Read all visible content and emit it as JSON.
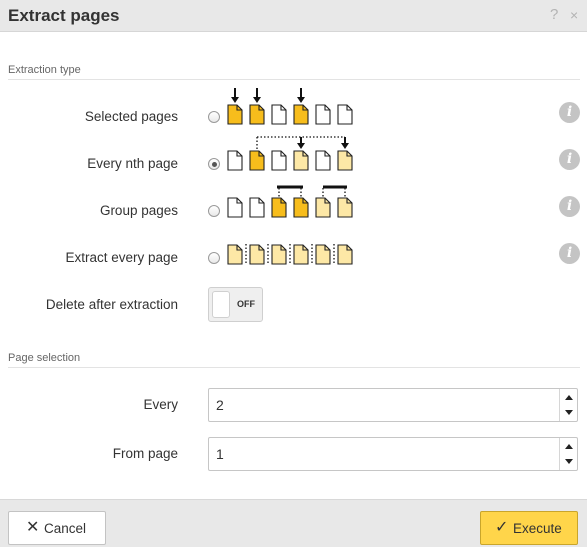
{
  "dialog": {
    "title": "Extract pages",
    "help_icon": "?",
    "close_icon": "×"
  },
  "extraction_type": {
    "section_title": "Extraction type",
    "options": [
      {
        "label": "Selected pages",
        "checked": false,
        "icon": "selected-pages-diagram"
      },
      {
        "label": "Every nth page",
        "checked": true,
        "icon": "every-nth-page-diagram"
      },
      {
        "label": "Group pages",
        "checked": false,
        "icon": "group-pages-diagram"
      },
      {
        "label": "Extract every page",
        "checked": false,
        "icon": "extract-every-page-diagram"
      }
    ],
    "info_glyph": "i",
    "delete_after": {
      "label": "Delete after extraction",
      "state": "OFF"
    }
  },
  "page_selection": {
    "section_title": "Page selection",
    "every": {
      "label": "Every",
      "value": "2"
    },
    "from_page": {
      "label": "From page",
      "value": "1"
    }
  },
  "footer": {
    "cancel_label": "Cancel",
    "cancel_icon": "✕",
    "execute_label": "Execute",
    "execute_icon": "✓"
  },
  "colors": {
    "page_selected": "#f7bd1c",
    "page_light": "#fde8a6",
    "page_blank": "#ffffff",
    "execute_button": "#ffd54a",
    "titlebar": "#e8e8e8"
  }
}
